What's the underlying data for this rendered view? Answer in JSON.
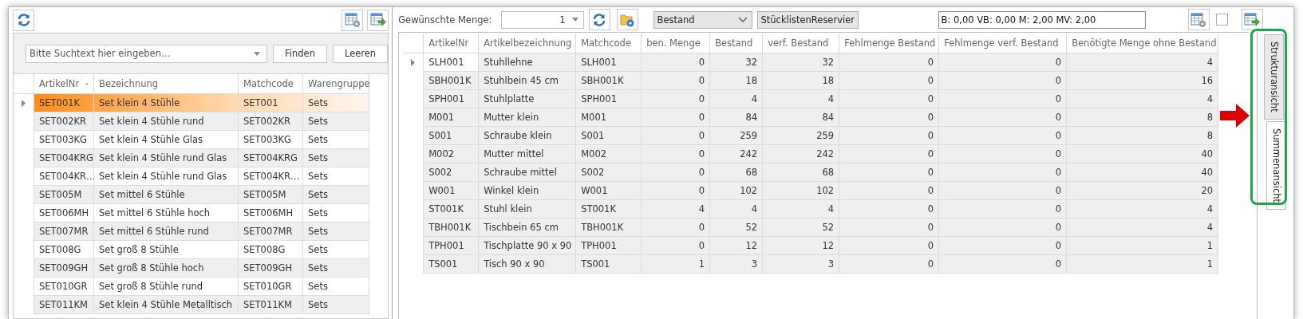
{
  "left_panel": {
    "search": {
      "placeholder": "Bitte Suchtext hier eingeben…",
      "buttons": [
        "Finden",
        "Leeren"
      ]
    },
    "table": {
      "columns": [
        {
          "label": "ArtikelNr",
          "sorted": true
        },
        {
          "label": "Bezeichnung",
          "sorted": false
        },
        {
          "label": "Matchcode",
          "sorted": false
        },
        {
          "label": "Warengruppe",
          "sorted": false
        }
      ],
      "rows": [
        {
          "cells": [
            "SET001K",
            "Set klein 4 Stühle",
            "SET001",
            "Sets"
          ],
          "selected": true
        },
        {
          "cells": [
            "SET002KR",
            "Set klein 4 Stühle rund",
            "SET002KR",
            "Sets"
          ],
          "selected": false
        },
        {
          "cells": [
            "SET003KG",
            "Set klein 4 Stühle Glas",
            "SET003KG",
            "Sets"
          ],
          "selected": false
        },
        {
          "cells": [
            "SET004KRG",
            "Set klein 4 Stühle rund Glas",
            "SET004KRG",
            "Sets"
          ],
          "selected": false
        },
        {
          "cells": [
            "SET004KR…",
            "Set klein 4 Stühle rund Glas",
            "SET004KR…",
            "Sets"
          ],
          "selected": false
        },
        {
          "cells": [
            "SET005M",
            "Set mittel 6 Stühle",
            "SET005M",
            "Sets"
          ],
          "selected": false
        },
        {
          "cells": [
            "SET006MH",
            "Set mittel 6 Stühle hoch",
            "SET006MH",
            "Sets"
          ],
          "selected": false
        },
        {
          "cells": [
            "SET007MR",
            "Set mittel 6 Stühle rund",
            "SET007MR",
            "Sets"
          ],
          "selected": false
        },
        {
          "cells": [
            "SET008G",
            "Set groß 8 Stühle",
            "SET008G",
            "Sets"
          ],
          "selected": false
        },
        {
          "cells": [
            "SET009GH",
            "Set groß 8 Stühle hoch",
            "SET009GH",
            "Sets"
          ],
          "selected": false
        },
        {
          "cells": [
            "SET010GR",
            "Set groß 8 Stühle rund",
            "SET010GR",
            "Sets"
          ],
          "selected": false
        },
        {
          "cells": [
            "SET011KM",
            "Set klein 4 Stühle Metalltisch",
            "SET011KM",
            "Sets"
          ],
          "selected": false
        }
      ]
    }
  },
  "right_panel": {
    "quantity": {
      "label": "Gewünschte Menge:",
      "value": "1"
    },
    "stock_mode": {
      "value": "Bestand"
    },
    "reservation_mode": {
      "value": "StücklistenReservier"
    },
    "summary": {
      "value": "B: 0,00 VB: 0,00 M: 2,00 MV: 2,00"
    },
    "checkbox": {
      "checked": false
    },
    "table": {
      "columns": [
        {
          "label": "ArtikelNr",
          "kind": "text"
        },
        {
          "label": "Artikelbezeichnung",
          "kind": "text"
        },
        {
          "label": "Matchcode",
          "kind": "text"
        },
        {
          "label": "ben. Menge",
          "kind": "number"
        },
        {
          "label": "Bestand",
          "kind": "number"
        },
        {
          "label": "verf. Bestand",
          "kind": "number"
        },
        {
          "label": "Fehlmenge Bestand",
          "kind": "number"
        },
        {
          "label": "Fehlmenge verf. Bestand",
          "kind": "number"
        },
        {
          "label": "Benötigte Menge ohne Bestand",
          "kind": "number"
        }
      ],
      "rows": [
        {
          "cells": [
            "SLH001",
            "Stuhllehne",
            "SLH001",
            "0",
            "32",
            "32",
            "0",
            "0",
            "4"
          ],
          "selected": true
        },
        {
          "cells": [
            "SBH001K",
            "Stuhlbein 45 cm",
            "SBH001K",
            "0",
            "18",
            "18",
            "0",
            "0",
            "16"
          ],
          "selected": false
        },
        {
          "cells": [
            "SPH001",
            "Stuhlplatte",
            "SPH001",
            "0",
            "4",
            "4",
            "0",
            "0",
            "4"
          ],
          "selected": false
        },
        {
          "cells": [
            "M001",
            "Mutter klein",
            "M001",
            "0",
            "84",
            "84",
            "0",
            "0",
            "8"
          ],
          "selected": false
        },
        {
          "cells": [
            "S001",
            "Schraube klein",
            "S001",
            "0",
            "259",
            "259",
            "0",
            "0",
            "8"
          ],
          "selected": false
        },
        {
          "cells": [
            "M002",
            "Mutter mittel",
            "M002",
            "0",
            "242",
            "242",
            "0",
            "0",
            "40"
          ],
          "selected": false
        },
        {
          "cells": [
            "S002",
            "Schraube mittel",
            "S002",
            "0",
            "68",
            "68",
            "0",
            "0",
            "40"
          ],
          "selected": false
        },
        {
          "cells": [
            "W001",
            "Winkel klein",
            "W001",
            "0",
            "102",
            "102",
            "0",
            "0",
            "20"
          ],
          "selected": false
        },
        {
          "cells": [
            "ST001K",
            "Stuhl klein",
            "ST001K",
            "4",
            "4",
            "4",
            "0",
            "0",
            "4"
          ],
          "selected": false
        },
        {
          "cells": [
            "TBH001K",
            "Tischbein 65 cm",
            "TBH001K",
            "0",
            "52",
            "52",
            "0",
            "0",
            "4"
          ],
          "selected": false
        },
        {
          "cells": [
            "TPH001",
            "Tischplatte 90 x 90",
            "TPH001",
            "0",
            "12",
            "12",
            "0",
            "0",
            "1"
          ],
          "selected": false
        },
        {
          "cells": [
            "TS001",
            "Tisch 90 x 90",
            "TS001",
            "1",
            "3",
            "3",
            "0",
            "0",
            "1"
          ],
          "selected": false
        }
      ]
    },
    "view_tabs": [
      {
        "label": "Strukturansicht",
        "selected": false
      },
      {
        "label": "Summenansicht",
        "selected": true
      }
    ]
  }
}
